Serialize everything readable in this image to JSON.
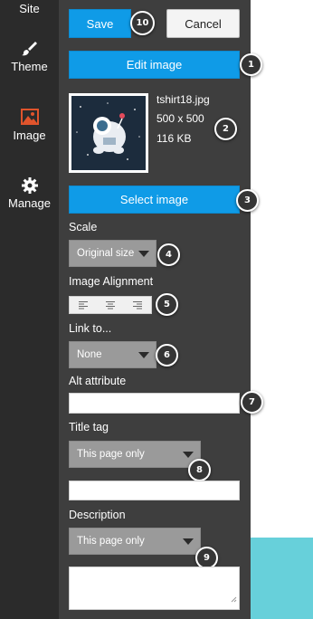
{
  "nav": {
    "items": [
      {
        "label": "Site",
        "icon": "site-icon"
      },
      {
        "label": "Theme",
        "icon": "brush-icon"
      },
      {
        "label": "Image",
        "icon": "image-icon"
      },
      {
        "label": "Manage",
        "icon": "gear-icon"
      }
    ]
  },
  "toolbar": {
    "save_label": "Save",
    "cancel_label": "Cancel"
  },
  "edit_image_label": "Edit image",
  "image": {
    "filename": "tshirt18.jpg",
    "dimensions": "500 x 500",
    "size": "116 KB"
  },
  "select_image_label": "Select image",
  "scale": {
    "label": "Scale",
    "value": "Original size"
  },
  "alignment": {
    "label": "Image Alignment",
    "options": [
      "left",
      "center",
      "right"
    ]
  },
  "link": {
    "label": "Link to...",
    "value": "None"
  },
  "alt": {
    "label": "Alt attribute",
    "value": ""
  },
  "title_tag": {
    "label": "Title tag",
    "value": "This page only",
    "text_value": ""
  },
  "description": {
    "label": "Description",
    "value": "This page only",
    "text_value": ""
  },
  "badges": [
    "1",
    "2",
    "3",
    "4",
    "5",
    "6",
    "7",
    "8",
    "9",
    "10"
  ],
  "colors": {
    "accent": "#0f9be7",
    "panel": "#3e3e3e",
    "nav": "#2b2b2b",
    "active_icon": "#e0542c",
    "teal": "#67d0da"
  }
}
